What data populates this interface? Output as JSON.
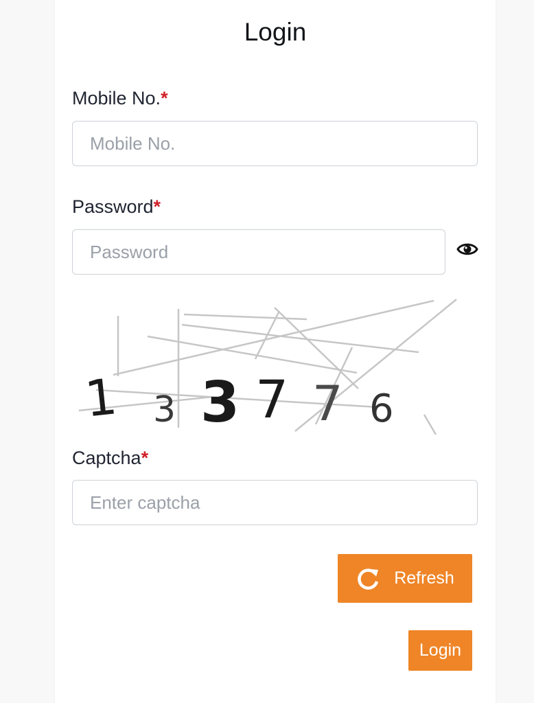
{
  "page": {
    "title": "Login"
  },
  "form": {
    "mobile": {
      "label": "Mobile No.",
      "required_mark": "*",
      "placeholder": "Mobile No.",
      "value": ""
    },
    "password": {
      "label": "Password",
      "required_mark": "*",
      "placeholder": "Password",
      "value": "",
      "toggle_icon": "eye-icon"
    },
    "captcha": {
      "digits": [
        "1",
        "3",
        "3",
        "7",
        "7",
        "6"
      ],
      "label": "Captcha",
      "required_mark": "*",
      "placeholder": "Enter captcha",
      "value": ""
    }
  },
  "buttons": {
    "refresh": {
      "label": "Refresh",
      "icon": "refresh-icon"
    },
    "login": {
      "label": "Login"
    }
  },
  "colors": {
    "accent": "#ef8527",
    "required": "#d0202a",
    "text": "#1f2430",
    "placeholder": "#9aa0a8",
    "border": "#cdd1d6"
  }
}
